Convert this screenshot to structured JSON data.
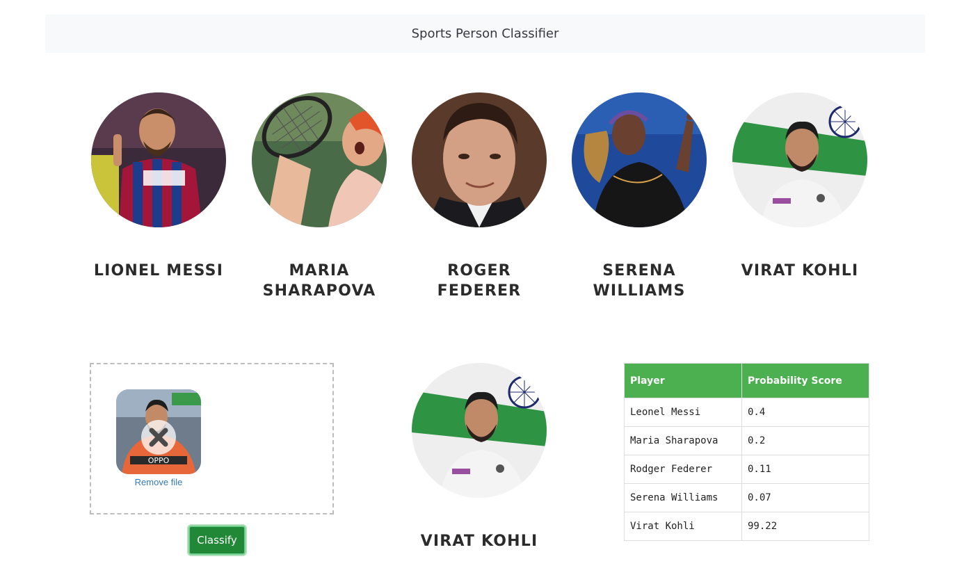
{
  "navbar": {
    "title": "Sports Person Classifier"
  },
  "players": [
    {
      "name": "Lionel Messi",
      "icon": "messi-photo"
    },
    {
      "name": "Maria Sharapova",
      "icon": "sharapova-photo"
    },
    {
      "name": "Roger Federer",
      "icon": "federer-photo"
    },
    {
      "name": "Serena Williams",
      "icon": "serena-photo"
    },
    {
      "name": "Virat Kohli",
      "icon": "kohli-photo"
    }
  ],
  "upload": {
    "remove_label": "Remove file",
    "classify_label": "Classify"
  },
  "result": {
    "name": "Virat Kohli"
  },
  "table": {
    "headers": [
      "Player",
      "Probability Score"
    ],
    "rows": [
      [
        "Leonel Messi",
        "0.4"
      ],
      [
        "Maria Sharapova",
        "0.2"
      ],
      [
        "Rodger Federer",
        "0.11"
      ],
      [
        "Serena Williams",
        "0.07"
      ],
      [
        "Virat Kohli",
        "99.22"
      ]
    ]
  },
  "colors": {
    "header_green": "#4caf50",
    "button_green": "#218838",
    "link_blue": "#337ab7",
    "navbar_bg": "#f8f9fa"
  }
}
